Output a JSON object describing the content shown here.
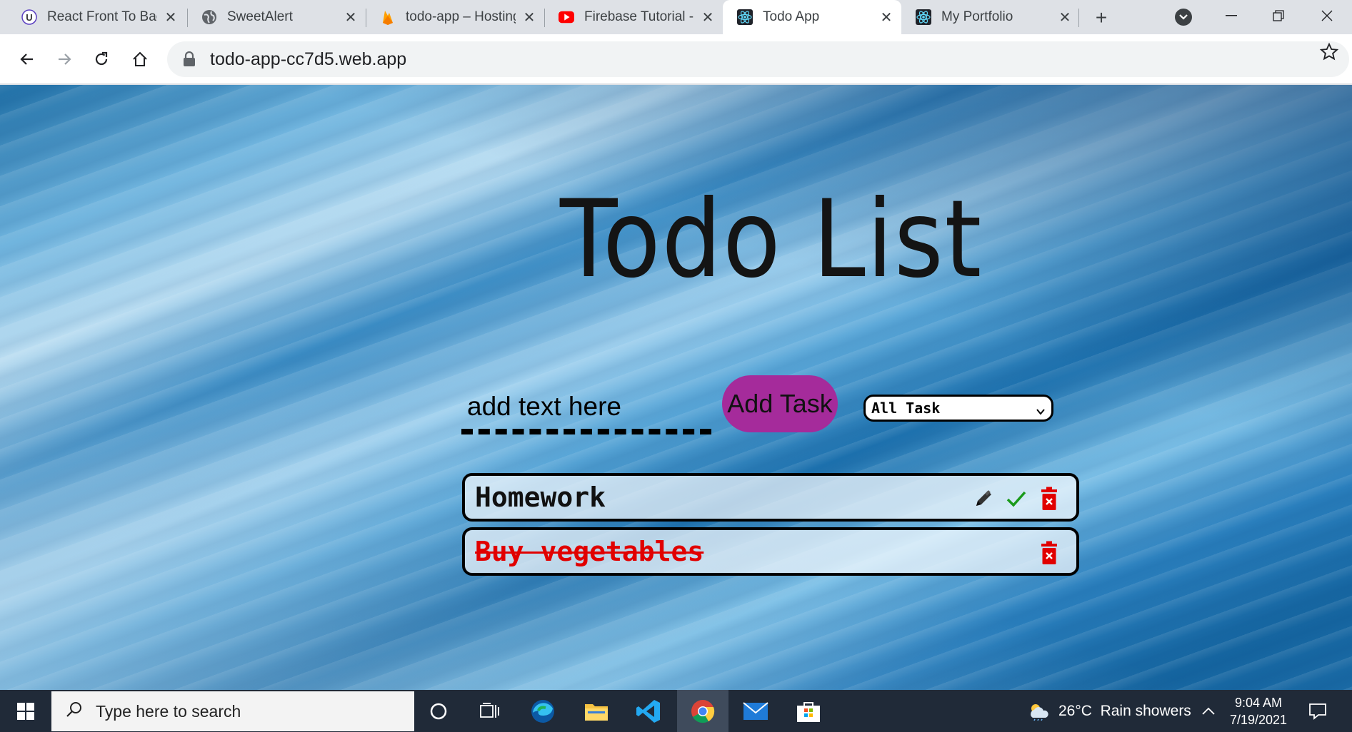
{
  "browser": {
    "tabs": [
      {
        "title": "React Front To Back",
        "favicon": "u-logo-icon",
        "active": false
      },
      {
        "title": "SweetAlert",
        "favicon": "globe-icon",
        "active": false
      },
      {
        "title": "todo-app – Hosting",
        "favicon": "firebase-icon",
        "active": false
      },
      {
        "title": "Firebase Tutorial - I",
        "favicon": "youtube-icon",
        "active": false
      },
      {
        "title": "Todo App",
        "favicon": "react-icon",
        "active": true
      },
      {
        "title": "My Portfolio",
        "favicon": "react-icon",
        "active": false
      }
    ],
    "url": "todo-app-cc7d5.web.app"
  },
  "app": {
    "title": "Todo List",
    "input_placeholder": "add text here",
    "add_button_label": "Add Task",
    "filter_selected": "All Task",
    "todos": [
      {
        "text": "Homework",
        "completed": false
      },
      {
        "text": "Buy vegetables",
        "completed": true
      }
    ],
    "colors": {
      "add_button": "#a52b9b",
      "completed_text": "#e10000",
      "delete_icon": "#e10000",
      "check_icon": "#1a9a1a"
    }
  },
  "taskbar": {
    "search_placeholder": "Type here to search",
    "weather": "26°C  Rain showers",
    "time": "9:04 AM",
    "date": "7/19/2021"
  }
}
